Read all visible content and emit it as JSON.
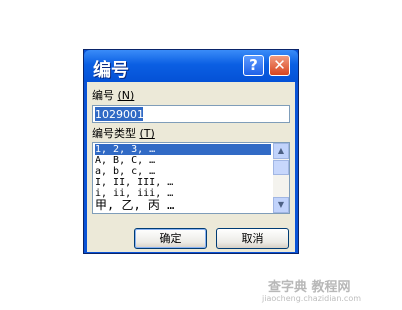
{
  "dialog": {
    "title": "编号",
    "help_button": "?",
    "close_button": "✕",
    "number_label": "编号 ",
    "number_accel": "(N)",
    "number_value": "1029001",
    "type_label": "编号类型 ",
    "type_accel": "(T)",
    "list_items": [
      "1, 2, 3, …",
      "A, B, C, …",
      "a, b, c, …",
      "I, II, III, …",
      "i, ii, iii, …",
      "甲, 乙, 丙 …"
    ],
    "selected_index": 0,
    "ok_label": "确定",
    "cancel_label": "取消"
  },
  "watermark": {
    "text": "查字典 教程网",
    "url": "jiaocheng.chazidian.com"
  }
}
